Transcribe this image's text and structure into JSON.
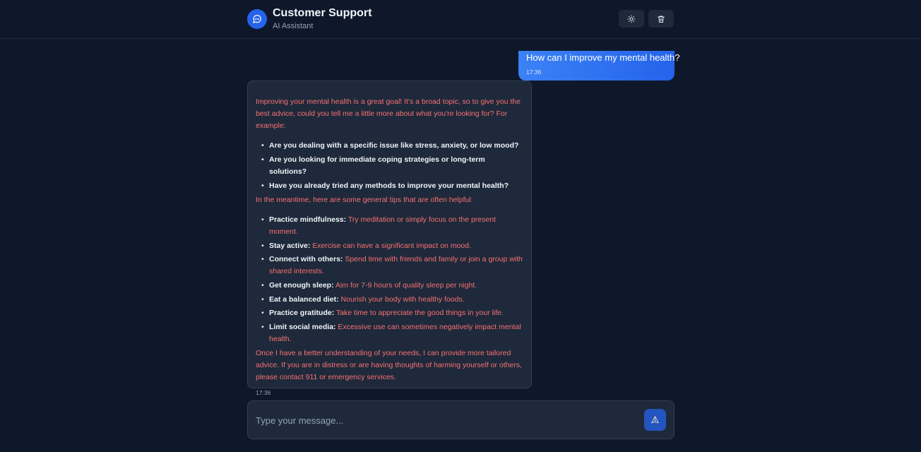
{
  "header": {
    "title": "Customer Support",
    "subtitle": "AI Assistant",
    "logo_icon": "chat-bubble-icon",
    "theme_icon": "sun-icon",
    "clear_icon": "trash-icon"
  },
  "colors": {
    "background": "#0f172a",
    "accent": "#2563eb",
    "bot_text": "#f87171",
    "bubble": "#1e293b"
  },
  "messages": {
    "user": {
      "text": "How can I improve my mental health?",
      "time": "17:36"
    },
    "bot": {
      "intro": "Improving your mental health is a great goal! It's a broad topic, so to give you the best advice, could you tell me a little more about what you're looking for? For example:",
      "questions": [
        "Are you dealing with a specific issue like stress, anxiety, or low mood?",
        "Are you looking for immediate coping strategies or long-term solutions?",
        "Have you already tried any methods to improve your mental health?"
      ],
      "tips_intro": "In the meantime, here are some general tips that are often helpful:",
      "tips": [
        {
          "label": "Practice mindfulness:",
          "text": "Try meditation or simply focus on the present moment."
        },
        {
          "label": "Stay active:",
          "text": "Exercise can have a significant impact on mood."
        },
        {
          "label": "Connect with others:",
          "text": "Spend time with friends and family or join a group with shared interests."
        },
        {
          "label": "Get enough sleep:",
          "text": "Aim for 7-9 hours of quality sleep per night."
        },
        {
          "label": "Eat a balanced diet:",
          "text": "Nourish your body with healthy foods."
        },
        {
          "label": "Practice gratitude:",
          "text": "Take time to appreciate the good things in your life."
        },
        {
          "label": "Limit social media:",
          "text": "Excessive use can sometimes negatively impact mental health."
        }
      ],
      "closing": "Once I have a better understanding of your needs, I can provide more tailored advice. If you are in distress or are having thoughts of harming yourself or others, please contact 911 or emergency services.",
      "time": "17:36"
    }
  },
  "composer": {
    "placeholder": "Type your message...",
    "send_icon": "send-icon"
  }
}
